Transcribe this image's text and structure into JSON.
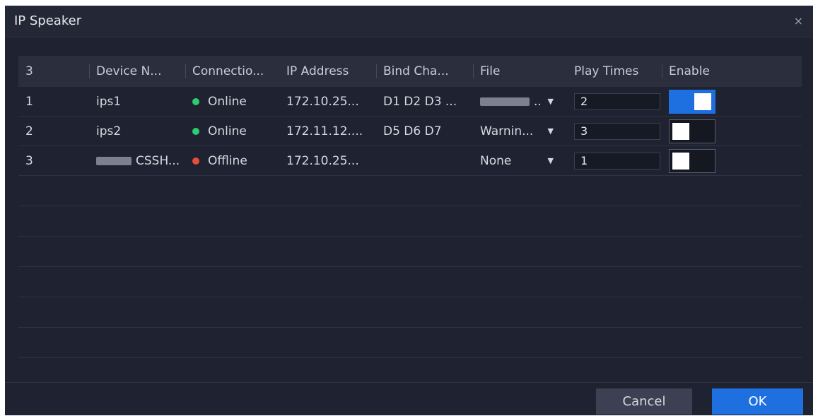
{
  "dialog": {
    "title": "IP Speaker",
    "close_glyph": "×"
  },
  "table": {
    "columns": [
      "3",
      "Device N...",
      "Connectio...",
      "IP Address",
      "Bind Cha...",
      "File",
      "Play Times",
      "Enable"
    ],
    "rows": [
      {
        "index": "1",
        "device_name": "ips1",
        "status": "Online",
        "status_color": "#2ecc71",
        "ip": "172.10.25...",
        "bind_channel": "D1 D2 D3 ...",
        "file": "..",
        "play_times": "2",
        "enabled": true
      },
      {
        "index": "2",
        "device_name": "ips2",
        "status": "Online",
        "status_color": "#2ecc71",
        "ip": "172.11.12....",
        "bind_channel": "D5 D6 D7",
        "file": "Warnin...",
        "play_times": "3",
        "enabled": false
      },
      {
        "index": "3",
        "device_name": "CSSH...",
        "status": "Offline",
        "status_color": "#e74c3c",
        "ip": "172.10.25...",
        "bind_channel": "",
        "file": "None",
        "play_times": "1",
        "enabled": false
      }
    ],
    "empty_rows": 6
  },
  "footer": {
    "cancel_label": "Cancel",
    "ok_label": "OK"
  },
  "colors": {
    "accent": "#1e6fe0",
    "background": "#1f2230",
    "online": "#2ecc71",
    "offline": "#e74c3c"
  }
}
